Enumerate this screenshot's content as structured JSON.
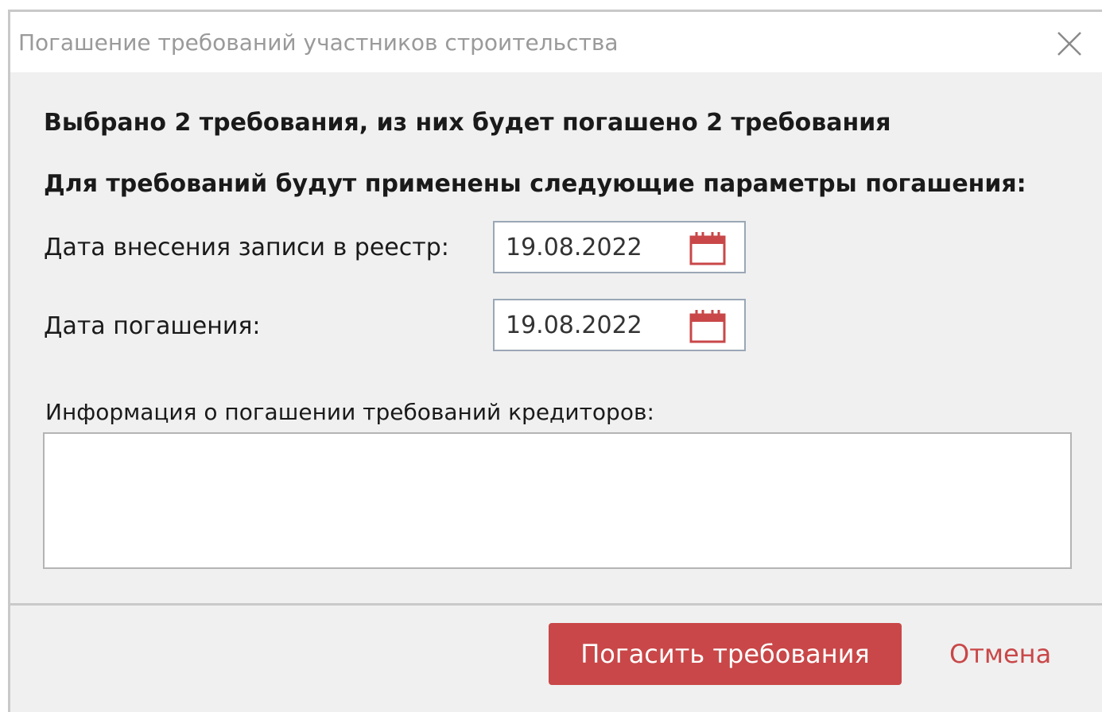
{
  "dialog": {
    "title": "Погашение требований участников строительства",
    "close_icon": "close-icon"
  },
  "summary": {
    "selected_text": "Выбрано 2 требования, из них будет погашено 2 требования",
    "params_heading": "Для требований будут применены следующие параметры погашения:"
  },
  "fields": {
    "registry_date": {
      "label": "Дата внесения записи в реестр:",
      "value": "19.08.2022",
      "icon": "calendar-icon"
    },
    "repayment_date": {
      "label": "Дата погашения:",
      "value": "19.08.2022",
      "icon": "calendar-icon"
    },
    "info": {
      "label": "Информация о погашении требований кредиторов:",
      "value": ""
    }
  },
  "footer": {
    "submit_label": "Погасить требования",
    "cancel_label": "Отмена"
  },
  "colors": {
    "accent": "#c94748",
    "background": "#f0f0f0",
    "title_text": "#9a9a9a"
  }
}
